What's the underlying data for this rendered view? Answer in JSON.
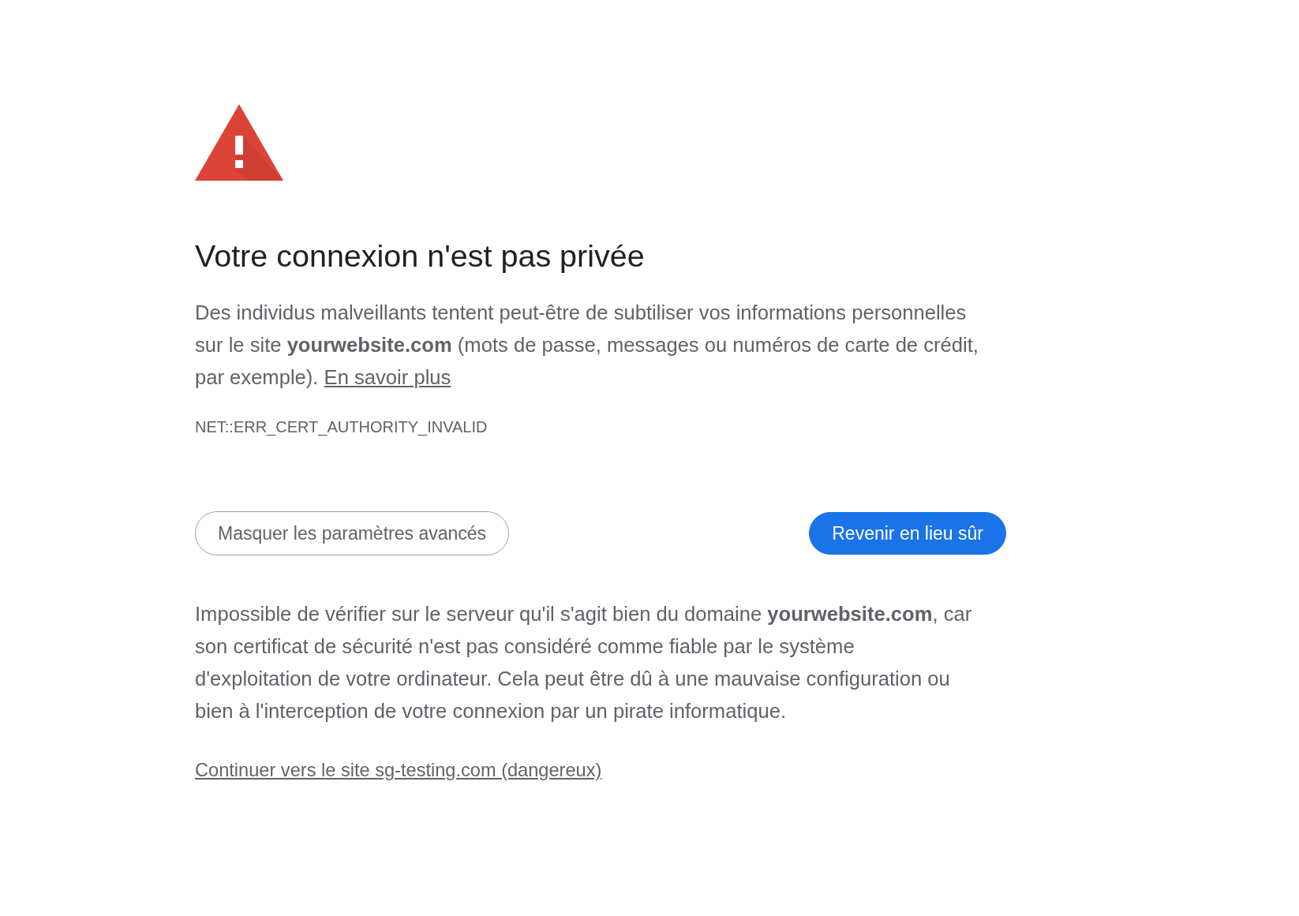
{
  "heading": "Votre connexion n'est pas privée",
  "explanation": "Des individus malveillants tentent peut-être de subtiliser vos informations personnelles sur le site **yourwebsite.com** (mots de passe, messages ou numéros de carte de crédit, par exemple).",
  "learn_more_link": "En savoir plus",
  "error_code": "NET::ERR_CERT_AUTHORITY_INVALID",
  "buttons": [
    {
      "kind": "outline",
      "label": "Masquer les paramètres avancés"
    },
    {
      "kind": "primary",
      "label": "Revenir en lieu sûr"
    }
  ],
  "details": "Impossible de vérifier sur le serveur qu'il s'agit bien du domaine **yourwebsite.com**, car son certificat de sécurité n'est pas considéré comme fiable par le système d'exploitation de votre ordinateur. Cela peut être dû à une mauvaise configuration ou bien à l'interception de votre connexion par un pirate informatique.",
  "proceed_link": "Continuer vers le site sg-testing.com (dangereux)"
}
